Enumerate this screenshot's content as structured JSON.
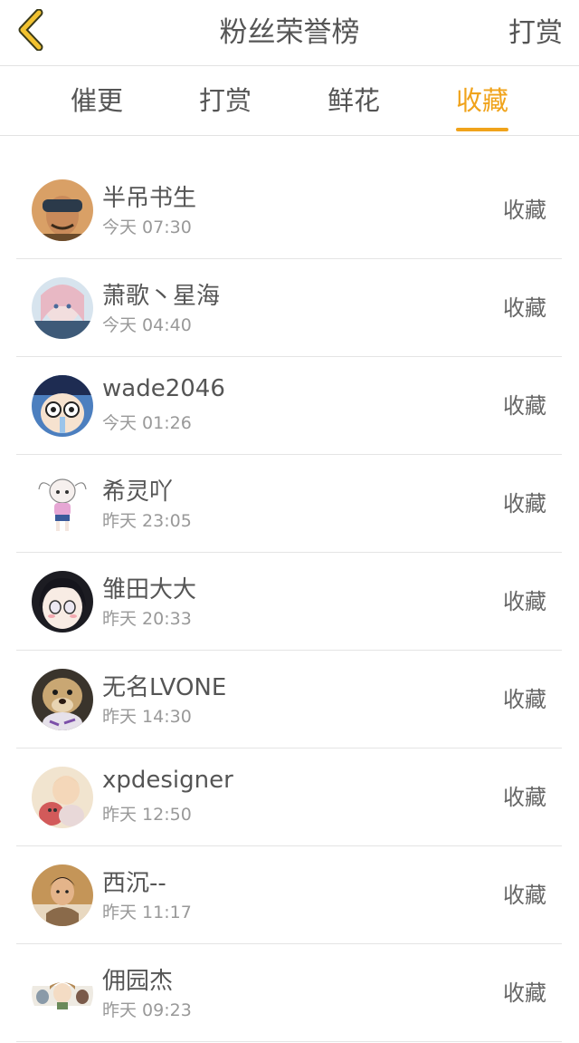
{
  "header": {
    "title": "粉丝荣誉榜",
    "back_icon": "chevron-left-icon",
    "right_label": "打赏",
    "accent_color": "#f0a31b"
  },
  "tabs": [
    {
      "label": "催更",
      "active": false
    },
    {
      "label": "打赏",
      "active": false
    },
    {
      "label": "鲜花",
      "active": false
    },
    {
      "label": "收藏",
      "active": true
    }
  ],
  "fans": [
    {
      "name": "半吊书生",
      "time": "今天 07:30",
      "action": "收藏"
    },
    {
      "name": "萧歌丶星海",
      "time": "今天 04:40",
      "action": "收藏"
    },
    {
      "name": "wade2046",
      "time": "今天 01:26",
      "action": "收藏"
    },
    {
      "name": "希灵吖",
      "time": "昨天 23:05",
      "action": "收藏"
    },
    {
      "name": "雏田大大",
      "time": "昨天 20:33",
      "action": "收藏"
    },
    {
      "name": "无名LVONE",
      "time": "昨天 14:30",
      "action": "收藏"
    },
    {
      "name": "xpdesigner",
      "time": "昨天 12:50",
      "action": "收藏"
    },
    {
      "name": "西沉--",
      "time": "昨天 11:17",
      "action": "收藏"
    },
    {
      "name": "佣园杰",
      "time": "昨天 09:23",
      "action": "收藏"
    }
  ]
}
